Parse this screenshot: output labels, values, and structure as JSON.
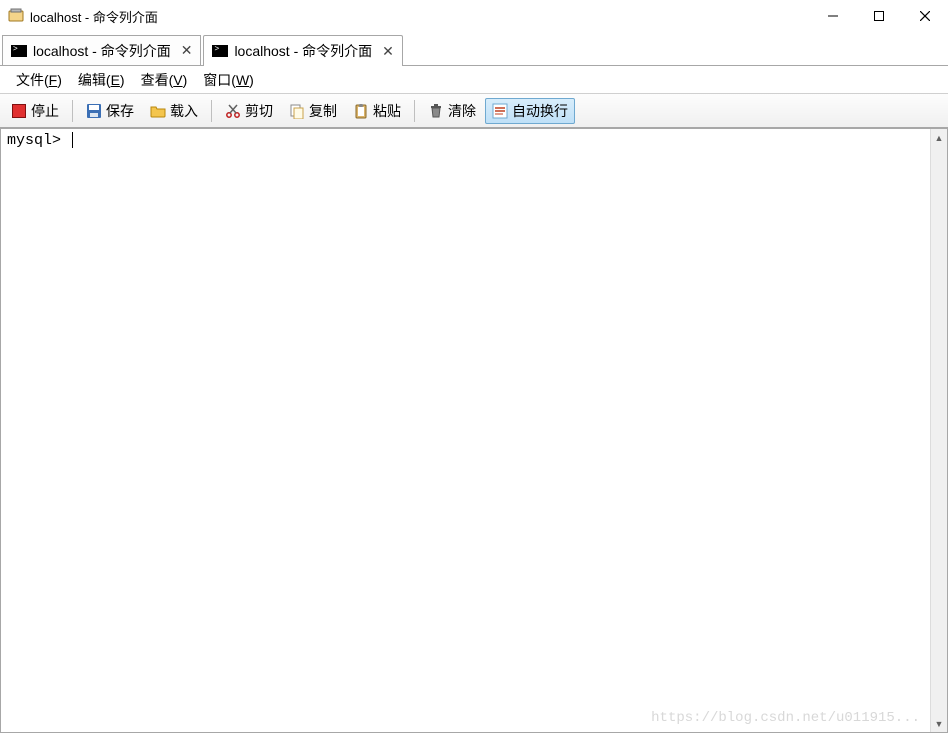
{
  "title": "localhost - 命令列介面",
  "tabs": [
    {
      "label": "localhost - 命令列介面",
      "active": false
    },
    {
      "label": "localhost - 命令列介面",
      "active": true
    }
  ],
  "menus": {
    "file": {
      "label": "文件",
      "accel": "F"
    },
    "edit": {
      "label": "编辑",
      "accel": "E"
    },
    "view": {
      "label": "查看",
      "accel": "V"
    },
    "window": {
      "label": "窗口",
      "accel": "W"
    }
  },
  "toolbar": {
    "stop": "停止",
    "save": "保存",
    "load": "载入",
    "cut": "剪切",
    "copy": "复制",
    "paste": "粘贴",
    "clear": "清除",
    "wrap": "自动换行"
  },
  "terminal": {
    "prompt": "mysql> "
  },
  "watermark": "https://blog.csdn.net/u011915..."
}
